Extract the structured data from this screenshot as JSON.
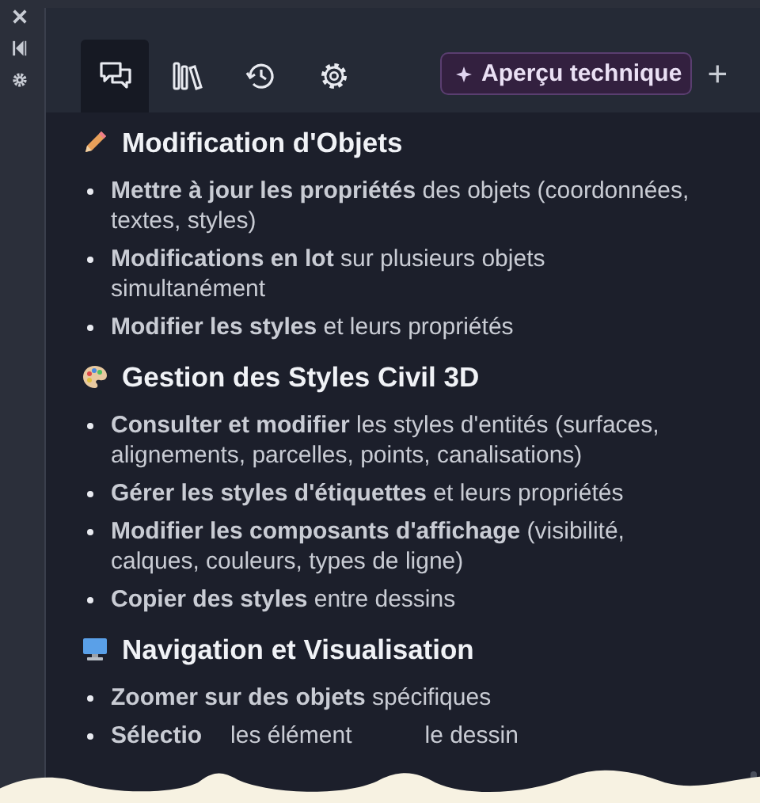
{
  "side_toolbar": [
    {
      "kind": "close"
    },
    {
      "kind": "collapse"
    },
    {
      "kind": "settings"
    }
  ],
  "tabs": [
    {
      "kind": "chat",
      "selected": true
    },
    {
      "kind": "library",
      "selected": false
    },
    {
      "kind": "history",
      "selected": false
    },
    {
      "kind": "settings",
      "selected": false
    }
  ],
  "preview_button": {
    "label": "Aperçu technique"
  },
  "add_button": {
    "label": "+"
  },
  "sections": [
    {
      "kind": "pencil",
      "title": "Modification d'Objets",
      "items": [
        "**Mettre à jour les propriétés** des objets (coordonnées, textes, styles)",
        "**Modifications en lot** sur plusieurs objets simultanément",
        "**Modifier les styles** et leurs propriétés"
      ]
    },
    {
      "kind": "palette",
      "title": "Gestion des Styles Civil 3D",
      "items": [
        "**Consulter et modifier** les styles d'entités (surfaces, alignements, parcelles, points, canalisations)",
        "**Gérer les styles d'étiquettes** et leurs propriétés",
        "**Modifier les composants d'affichage** (visibilité, calques, couleurs, types de ligne)",
        "**Copier des styles** entre dessins"
      ]
    },
    {
      "kind": "monitor",
      "title": "Navigation et Visualisation",
      "items": [
        "**Zoomer sur des objets** spécifiques"
      ],
      "torn_item": [
        "**Sélectio**",
        "les élément",
        "le dessin"
      ]
    }
  ]
}
